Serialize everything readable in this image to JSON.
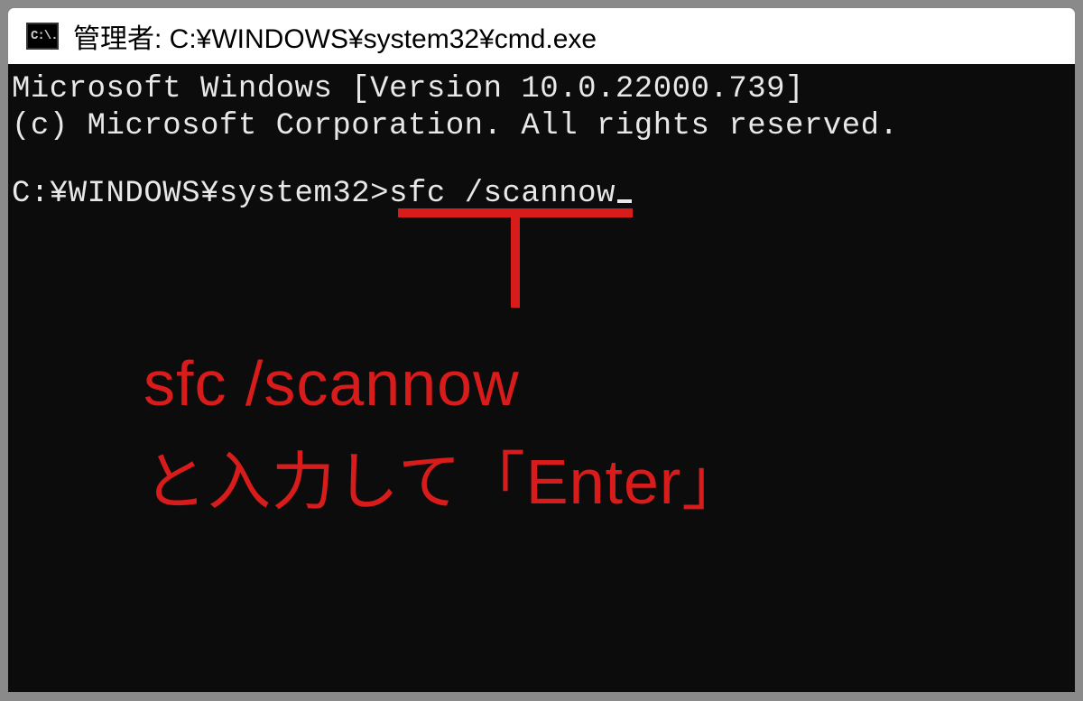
{
  "window": {
    "icon_label": "C:\\.",
    "title": "管理者: C:¥WINDOWS¥system32¥cmd.exe"
  },
  "terminal": {
    "line1": "Microsoft Windows [Version 10.0.22000.739]",
    "line2": "(c) Microsoft Corporation. All rights reserved.",
    "prompt": "C:¥WINDOWS¥system32>",
    "command": "sfc /scannow"
  },
  "annotation": {
    "line1": "sfc /scannow",
    "line2": "と入力して「Enter」"
  },
  "colors": {
    "annotation": "#d81b1b",
    "terminal_bg": "#0c0c0c",
    "terminal_fg": "#e8e8e8"
  }
}
